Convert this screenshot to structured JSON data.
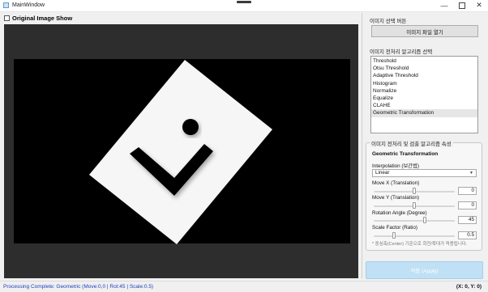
{
  "window": {
    "title": "MainWindow"
  },
  "viewer": {
    "show_original_label": "Original Image Show",
    "show_original_checked": false
  },
  "open_section": {
    "title": "이미지 선택 버튼",
    "button_label": "이미지 파일 열기"
  },
  "algo_section": {
    "title": "이미지 전처리 알고리즘 선택",
    "items": [
      "Threshold",
      "Otsu Threshold",
      "Adaptive Threshold",
      "Histogram",
      "Normalize",
      "Equalize",
      "CLAHE",
      "Geometric Transformation"
    ],
    "selected": "Geometric Transformation"
  },
  "props": {
    "title": "이미지 전처리 및 검출 알고리즘 속성",
    "subtitle": "Geometric Transformation",
    "interp_label": "Interpolation (보간법)",
    "interp_value": "Linear",
    "move_x": {
      "label": "Move X (Translation)",
      "value": "0",
      "fraction": 0.5
    },
    "move_y": {
      "label": "Move Y (Translation)",
      "value": "0",
      "fraction": 0.5
    },
    "rotation": {
      "label": "Rotation Angle (Degree)",
      "value": "45",
      "fraction": 0.625
    },
    "scale": {
      "label": "Scale Factor (Ratio)",
      "value": "0.5",
      "fraction": 0.25
    },
    "hint": "* 중심축(Center) 기준으로 회전/확대가 적용됩니다."
  },
  "apply_button": {
    "label": "적용 (Apply)"
  },
  "status": {
    "text": "Processing Complete: Geometric (Move:0,0 | Rot:45 | Scale:0.5)",
    "coords": "(X: 0, Y: 0)"
  },
  "colors": {
    "viewer_bg": "#2d2d2d",
    "image_bg": "#000000",
    "status_text": "#1f3fbf",
    "apply_bg": "#bfe0f5"
  }
}
